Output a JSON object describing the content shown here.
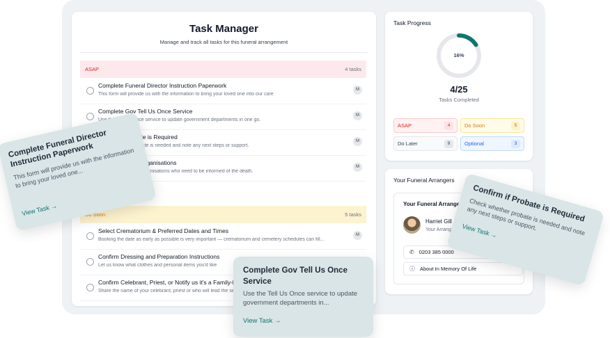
{
  "header": {
    "title": "Task Manager",
    "subtitle": "Manage and track all tasks for this funeral arrangement"
  },
  "sections": [
    {
      "name": "ASAP",
      "count_label": "4 tasks",
      "tasks": [
        {
          "title": "Complete Funeral Director Instruction Paperwork",
          "desc": "This form will provide us with the information to bring your loved one into our care",
          "badge": "M"
        },
        {
          "title": "Complete Gov Tell Us Once Service",
          "desc": "Use the Tell Us Once service to update government departments in one go.",
          "badge": "M"
        },
        {
          "title": "Confirm if Probate is Required",
          "desc": "Check whether probate is needed and note any next steps or support.",
          "badge": "M"
        },
        {
          "title": "Notify Relevant Organisations",
          "desc": "Make a list of other organisations who need to be informed of the death.",
          "badge": "M"
        }
      ]
    },
    {
      "name": "Do Soon",
      "count_label": "5 tasks",
      "tasks": [
        {
          "title": "Select Crematorium & Preferred Dates and Times",
          "desc": "Booking the date as early as possible is very important — crematorium and cemetery schedules can fill...",
          "badge": "M"
        },
        {
          "title": "Confirm Dressing and Preparation Instructions",
          "desc": "Let us know what clothes and personal items you'd like",
          "badge": ""
        },
        {
          "title": "Confirm Celebrant, Priest, or Notify us it's a Family-led Service",
          "desc": "Share the name of your celebrant, priest or who will lead the service",
          "badge": ""
        }
      ]
    }
  ],
  "progress": {
    "title": "Task Progress",
    "percent_label": "16%",
    "percent_value": 0.16,
    "fraction": "4/25",
    "fraction_label": "Tasks Completed",
    "chips": [
      {
        "label": "ASAP",
        "count": "4"
      },
      {
        "label": "Do Soon",
        "count": "5"
      },
      {
        "label": "Do Later",
        "count": "9"
      },
      {
        "label": "Optional",
        "count": "3"
      }
    ],
    "ring_color": "#0f766e",
    "ring_track_color": "#e5e7eb"
  },
  "arrangers": {
    "title": "Your Funeral Arrangers",
    "card_title": "Your Funeral Arranger",
    "name": "Harriet Gill",
    "role": "Your Arranger",
    "phone": "0203 385 0000",
    "memory_label": "About In Memory Of Life"
  },
  "floating_cards": [
    {
      "title": "Complete Funeral Director Instruction Paperwork",
      "desc": "This form will provide us with the information to bring your loved one...",
      "link": "View Task →"
    },
    {
      "title": "Complete Gov Tell Us Once Service",
      "desc": "Use the Tell Us Once service to update government departments in...",
      "link": "View Task →"
    },
    {
      "title": "Confirm if Probate is Required",
      "desc": "Check whether probate is needed and note any next steps or support.",
      "link": "View Task →"
    }
  ],
  "colors": {
    "accent": "#0f766e",
    "asap": "#dc2626",
    "do_soon": "#d97706",
    "optional": "#2563eb",
    "float_card_bg": "#d9e5e7"
  }
}
